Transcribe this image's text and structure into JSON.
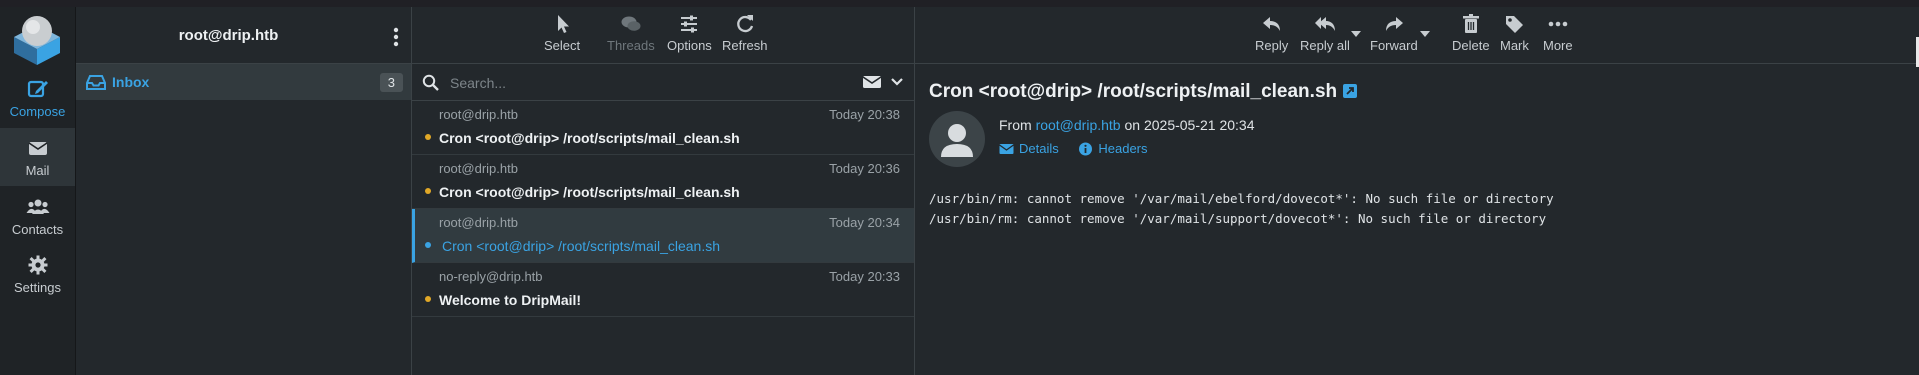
{
  "nav": {
    "compose": "Compose",
    "mail": "Mail",
    "contacts": "Contacts",
    "settings": "Settings"
  },
  "folders": {
    "account": "root@drip.htb",
    "items": [
      {
        "label": "Inbox",
        "count": "3"
      }
    ]
  },
  "list_toolbar": {
    "select": "Select",
    "threads": "Threads",
    "options": "Options",
    "refresh": "Refresh"
  },
  "search": {
    "placeholder": "Search..."
  },
  "messages": [
    {
      "from": "root@drip.htb",
      "date": "Today 20:38",
      "subject": "Cron <root@drip> /root/scripts/mail_clean.sh"
    },
    {
      "from": "root@drip.htb",
      "date": "Today 20:36",
      "subject": "Cron <root@drip> /root/scripts/mail_clean.sh"
    },
    {
      "from": "root@drip.htb",
      "date": "Today 20:34",
      "subject": "Cron <root@drip> /root/scripts/mail_clean.sh"
    },
    {
      "from": "no-reply@drip.htb",
      "date": "Today 20:33",
      "subject": "Welcome to DripMail!"
    }
  ],
  "preview_toolbar": {
    "reply": "Reply",
    "reply_all": "Reply all",
    "forward": "Forward",
    "delete": "Delete",
    "mark": "Mark",
    "more": "More"
  },
  "preview": {
    "subject": "Cron <root@drip> /root/scripts/mail_clean.sh",
    "from_prefix": "From",
    "from_addr": "root@drip.htb",
    "date_text": "on 2025-05-21 20:34",
    "details": "Details",
    "headers": "Headers",
    "body_line1": "/usr/bin/rm: cannot remove '/var/mail/ebelford/dovecot*': No such file or directory",
    "body_line2": "/usr/bin/rm: cannot remove '/var/mail/support/dovecot*': No such file or directory"
  },
  "colors": {
    "accent": "#3aa3e3",
    "unread_dot": "#e1a827",
    "background": "#23282c"
  },
  "icons": {
    "compose": "compose-icon",
    "mail": "envelope-icon",
    "contacts": "people-icon",
    "settings": "gear-icon",
    "select": "pointer-icon",
    "threads": "chat-icon",
    "options": "sliders-icon",
    "refresh": "refresh-icon",
    "reply": "reply-icon",
    "reply_all": "reply-all-icon",
    "forward": "forward-icon",
    "delete": "trash-icon",
    "mark": "tag-icon",
    "more": "dots-icon"
  }
}
